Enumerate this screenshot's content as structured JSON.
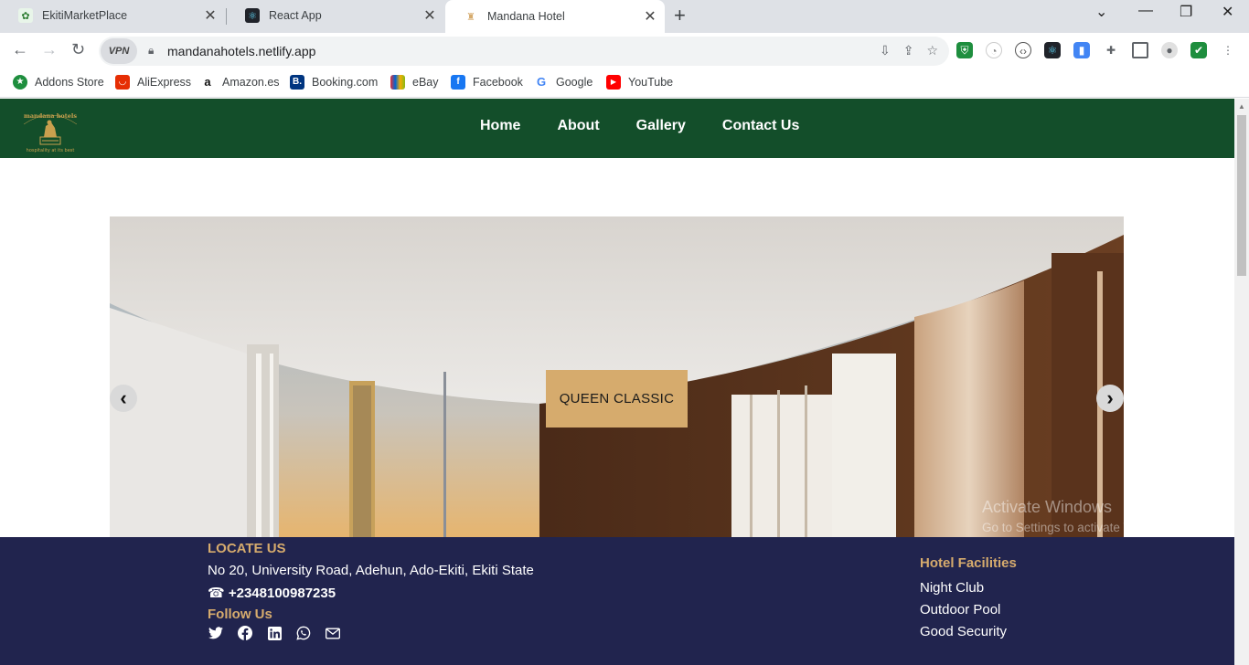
{
  "browser": {
    "tabs": [
      {
        "title": "EkitiMarketPlace",
        "icon": "market-icon"
      },
      {
        "title": "React App",
        "icon": "react-icon"
      },
      {
        "title": "Mandana Hotel",
        "icon": "hotel-icon"
      }
    ],
    "url": "mandanahotels.netlify.app",
    "vpn_label": "VPN",
    "bookmarks": [
      "Addons Store",
      "AliExpress",
      "Amazon.es",
      "Booking.com",
      "eBay",
      "Facebook",
      "Google",
      "YouTube"
    ]
  },
  "site": {
    "nav": [
      "Home",
      "About",
      "Gallery",
      "Contact Us"
    ],
    "logo_text": "mandana hotels",
    "logo_tagline": "hospitality at its best",
    "slide_caption": "QUEEN CLASSIC",
    "prev_arrow": "‹",
    "next_arrow": "›"
  },
  "footer": {
    "locate_title": "LOCATE US",
    "address": "No 20, University Road, Adehun, Ado-Ekiti, Ekiti State",
    "phone": "☎ +2348100987235",
    "follow_title": "Follow Us",
    "facilities_title": "Hotel Facilities",
    "facilities": [
      "Night Club",
      "Outdoor Pool",
      "Good Security"
    ]
  },
  "watermark": {
    "line1": "Activate Windows",
    "line2": "Go to Settings to activate Windows."
  },
  "colors": {
    "nav_bg": "#134e2a",
    "footer_bg": "#21244e",
    "accent": "#d6ab6d"
  }
}
